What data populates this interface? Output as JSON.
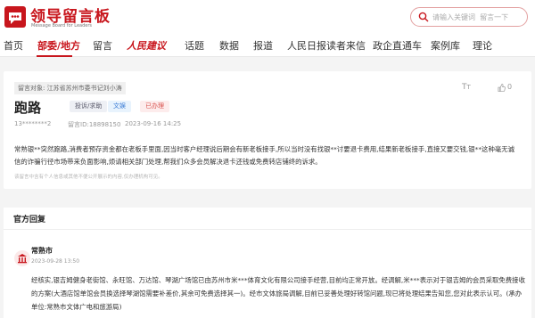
{
  "header": {
    "logo_title": "领导留言板",
    "logo_subtitle": "Message Board for Leaders",
    "search_placeholder": "请输入关键词  留言一下"
  },
  "nav": {
    "items": [
      {
        "label": "首页"
      },
      {
        "label": "部委/地方"
      },
      {
        "label": "留言"
      },
      {
        "label": "人民建议"
      },
      {
        "label": "话题"
      },
      {
        "label": "数据"
      },
      {
        "label": "报道"
      },
      {
        "label": "人民日报读者来信"
      },
      {
        "label": "政企直通车"
      },
      {
        "label": "案例库"
      },
      {
        "label": "理论"
      }
    ]
  },
  "post": {
    "target": "留言对象:  江苏省苏州市委书记刘小涛",
    "title": "跑路",
    "tags": {
      "type": "投诉/求助",
      "field": "文娱",
      "status": "已办理"
    },
    "author": "13********2",
    "id": "留言ID:18898150",
    "time": "2023-09-16 14:25",
    "like_count": "0",
    "tt_label": "T",
    "body": "常熟银**突然跑路,消费者预存资金都在老板手里面,因当时客户经理说后期会有新老板接手,所以当时没有找银**讨要退卡费用,结果新老板接手,直接又要交钱,银**这种毫无诚信的诈骗行径市场带来负面影响,烦请相关部门处理,帮我们众多会员解决退卡还钱或免费转店铺终的诉求。",
    "disclaimer": "该留言中含有个人信息或其他不便公开展示的内容,仅办理机构可见。"
  },
  "reply": {
    "heading": "官方回复",
    "org": "常熟市",
    "time": "2023-09-28 13:50",
    "body": "经核实,银吉姆健身老街馆、永旺馆、万达馆、琴湖广场馆已由苏州市米***体育文化有限公司接手经营,目前均正常开放。经调解,米***表示对于银吉姆的会员采取免费接收的方案(大酒店馆单馆会员换选择琴湖馆需要补差价,其余可免费选择其一)。经市文体旅局调解,目前已妥善处理好转馆问题,现已将处理结果告知您,您对此表示认可。(承办单位:常熟市文体广电和旅游局)"
  },
  "colors": {
    "brand_red": "#c8161d",
    "tag_blue": "#3a7bd5",
    "tag_red": "#d9534f"
  },
  "icons": {
    "search": "search-icon",
    "like": "thumbs-up-icon",
    "org": "government-building-icon",
    "logo": "message-board-logo-icon"
  }
}
